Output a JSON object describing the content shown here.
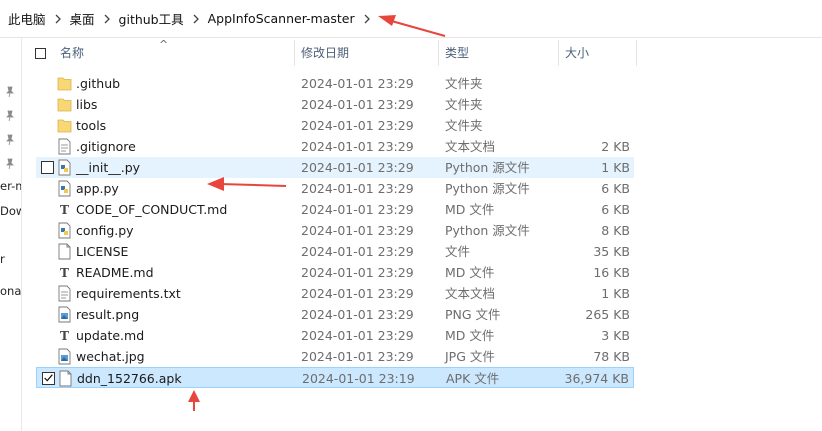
{
  "breadcrumb": [
    "此电脑",
    "桌面",
    "github工具",
    "AppInfoScanner-master"
  ],
  "left_nav": {
    "labels": [
      "er-m",
      "Dow",
      "r",
      "ona"
    ]
  },
  "columns": {
    "name": "名称",
    "date": "修改日期",
    "type": "类型",
    "size": "大小",
    "sort_indicator": "^"
  },
  "files": [
    {
      "name": ".github",
      "date": "2024-01-01 23:29",
      "type": "文件夹",
      "size": "",
      "icon": "folder-icon"
    },
    {
      "name": "libs",
      "date": "2024-01-01 23:29",
      "type": "文件夹",
      "size": "",
      "icon": "folder-icon"
    },
    {
      "name": "tools",
      "date": "2024-01-01 23:29",
      "type": "文件夹",
      "size": "",
      "icon": "folder-icon"
    },
    {
      "name": ".gitignore",
      "date": "2024-01-01 23:29",
      "type": "文本文档",
      "size": "2 KB",
      "icon": "text-file-icon"
    },
    {
      "name": "__init__.py",
      "date": "2024-01-01 23:29",
      "type": "Python 源文件",
      "size": "1 KB",
      "icon": "python-file-icon"
    },
    {
      "name": "app.py",
      "date": "2024-01-01 23:29",
      "type": "Python 源文件",
      "size": "6 KB",
      "icon": "python-file-icon"
    },
    {
      "name": "CODE_OF_CONDUCT.md",
      "date": "2024-01-01 23:29",
      "type": "MD 文件",
      "size": "6 KB",
      "icon": "md-file-icon"
    },
    {
      "name": "config.py",
      "date": "2024-01-01 23:29",
      "type": "Python 源文件",
      "size": "8 KB",
      "icon": "python-file-icon"
    },
    {
      "name": "LICENSE",
      "date": "2024-01-01 23:29",
      "type": "文件",
      "size": "35 KB",
      "icon": "blank-file-icon"
    },
    {
      "name": "README.md",
      "date": "2024-01-01 23:29",
      "type": "MD 文件",
      "size": "16 KB",
      "icon": "md-file-icon"
    },
    {
      "name": "requirements.txt",
      "date": "2024-01-01 23:29",
      "type": "文本文档",
      "size": "1 KB",
      "icon": "text-file-icon"
    },
    {
      "name": "result.png",
      "date": "2024-01-01 23:29",
      "type": "PNG 文件",
      "size": "265 KB",
      "icon": "image-file-icon"
    },
    {
      "name": "update.md",
      "date": "2024-01-01 23:29",
      "type": "MD 文件",
      "size": "3 KB",
      "icon": "md-file-icon"
    },
    {
      "name": "wechat.jpg",
      "date": "2024-01-01 23:29",
      "type": "JPG 文件",
      "size": "78 KB",
      "icon": "image-file-icon"
    },
    {
      "name": "ddn_152766.apk",
      "date": "2024-01-01 23:19",
      "type": "APK 文件",
      "size": "36,974 KB",
      "icon": "blank-file-icon"
    }
  ],
  "colors": {
    "selected_bg": "#cce8ff",
    "hover_bg": "#e5f3ff",
    "annotation_arrow": "#e8453c",
    "folder": "#f8d775"
  }
}
